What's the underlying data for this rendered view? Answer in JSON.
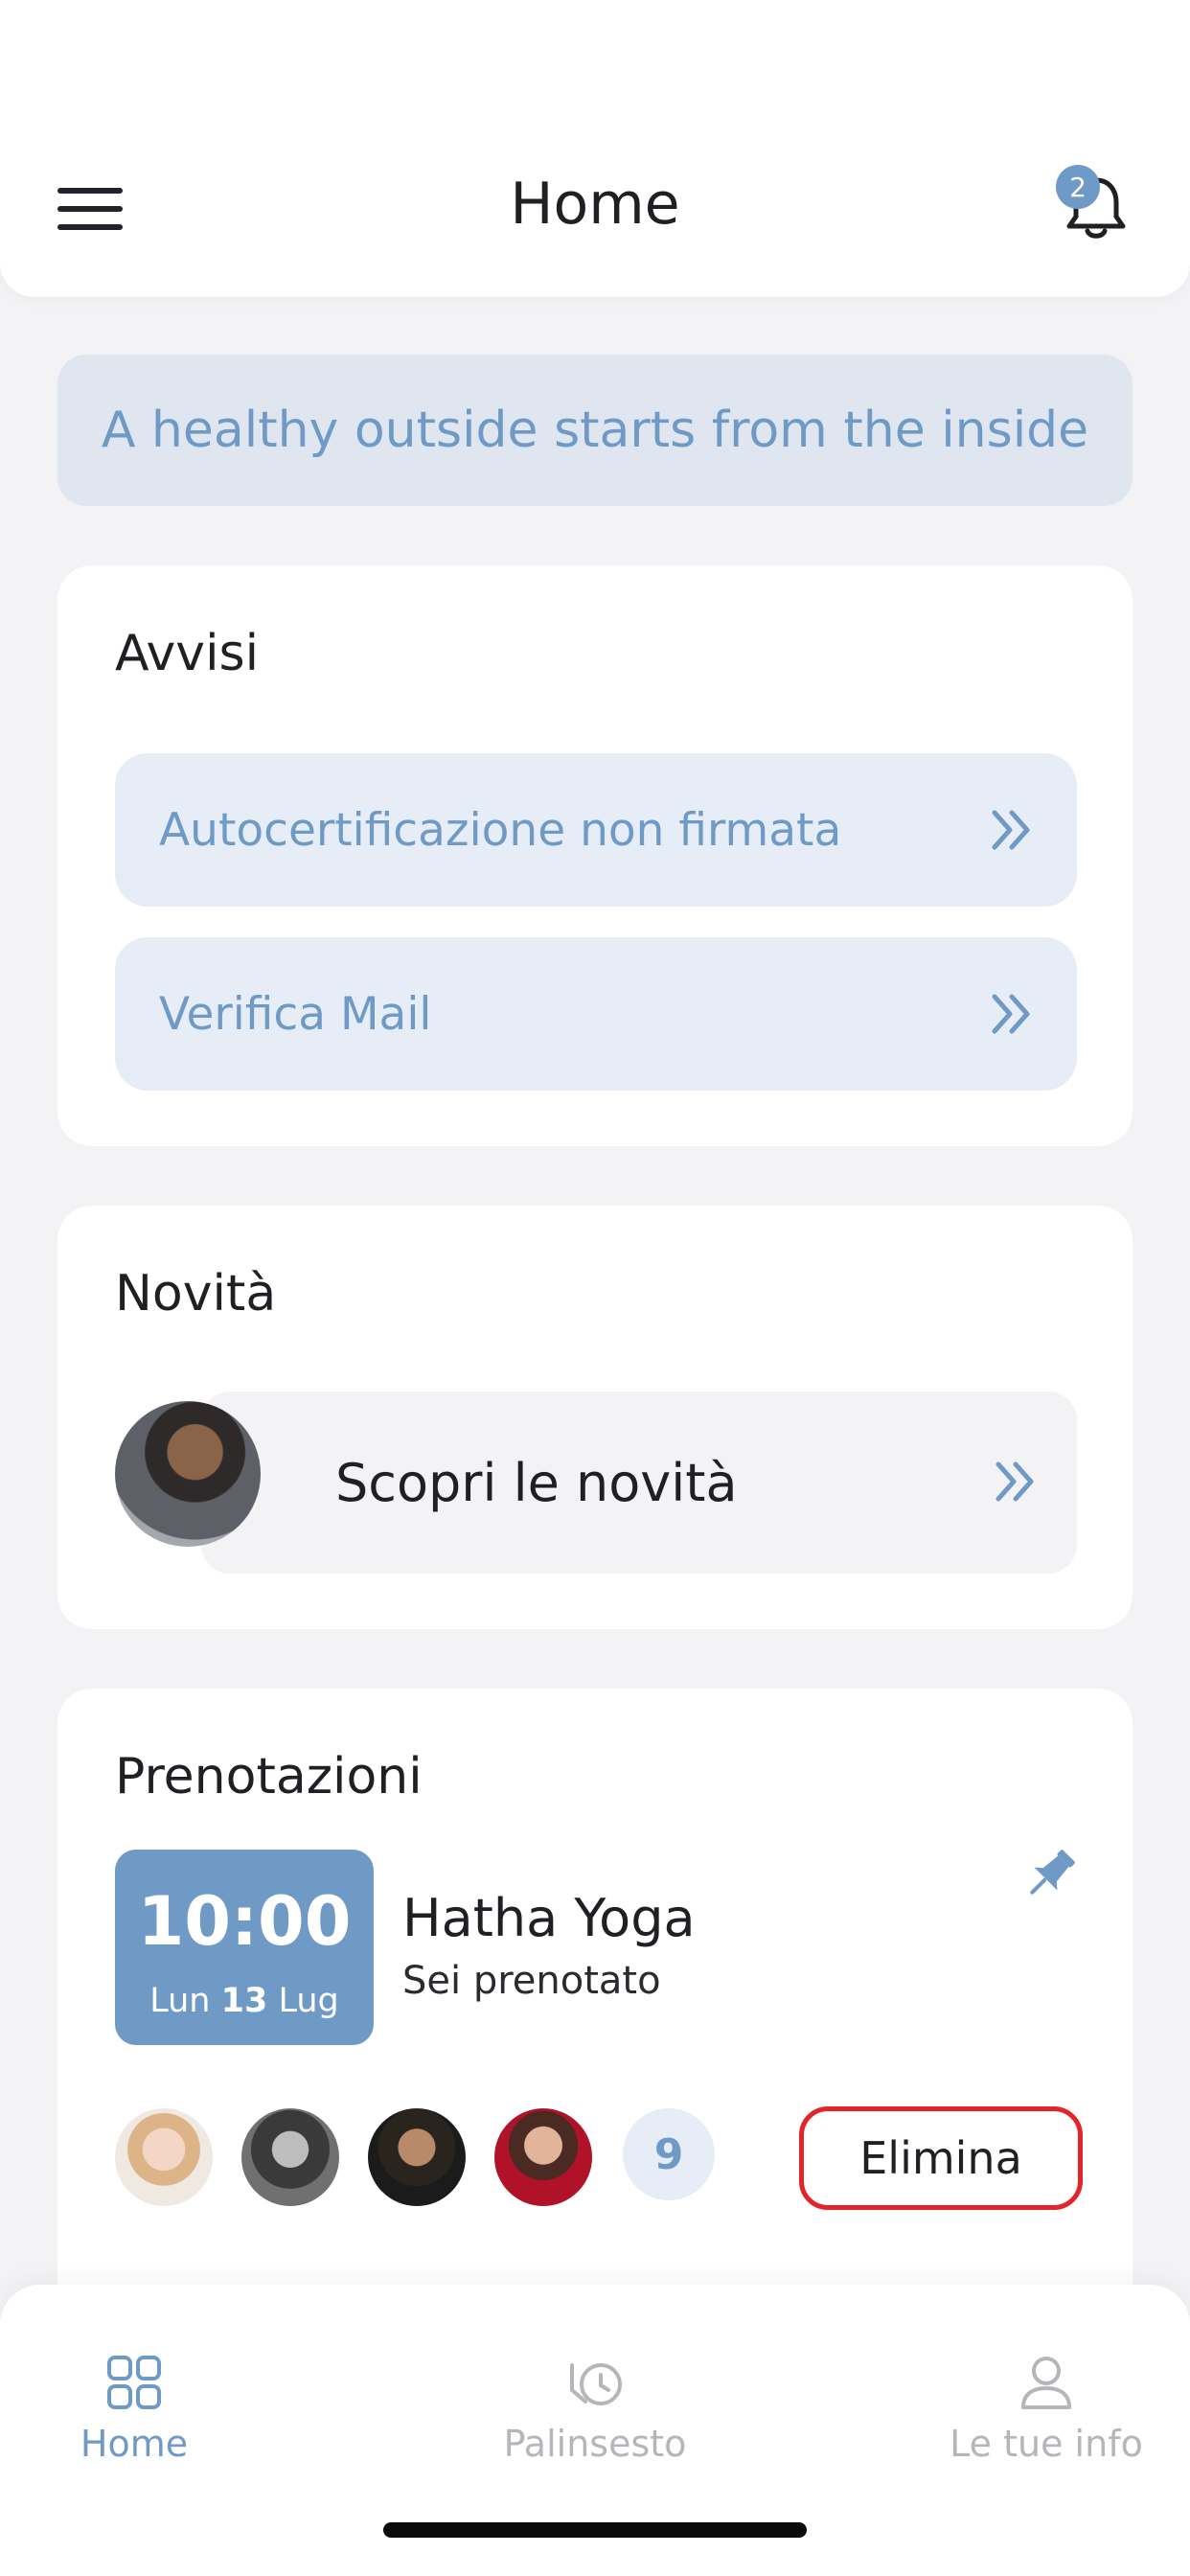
{
  "header": {
    "title": "Home",
    "notifications_count": "2"
  },
  "quote": "A healthy outside starts from the inside",
  "alerts": {
    "title": "Avvisi",
    "items": [
      {
        "label": "Autocertificazione non firmata"
      },
      {
        "label": "Verifica Mail"
      }
    ]
  },
  "news": {
    "title": "Novità",
    "cta": "Scopri le novità"
  },
  "bookings": {
    "title": "Prenotazioni",
    "time": "10:00",
    "date_day": "Lun",
    "date_num": "13",
    "date_month": "Lug",
    "class_name": "Hatha Yoga",
    "status": "Sei prenotato",
    "others_count": "9",
    "delete_label": "Elimina"
  },
  "tabs": [
    {
      "label": "Home",
      "icon": "grid-icon",
      "active": true
    },
    {
      "label": "Palinsesto",
      "icon": "history-icon",
      "active": false
    },
    {
      "label": "Le tue info",
      "icon": "user-icon",
      "active": false
    }
  ],
  "colors": {
    "accent": "#6f9ac6",
    "danger": "#e3242b",
    "inactive": "#b5b5ba"
  }
}
